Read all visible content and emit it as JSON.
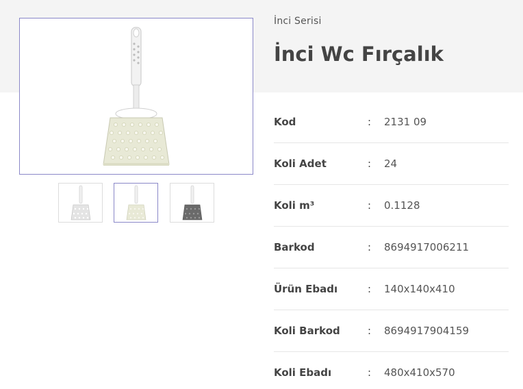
{
  "product": {
    "series": "İnci Serisi",
    "title": "İnci Wc Fırçalık"
  },
  "gallery": {
    "main_color": "#e8e9d6",
    "thumbnails": [
      {
        "color": "#e4e4e4",
        "icon": "brush-holder-white-thumbnail"
      },
      {
        "color": "#e8e9d6",
        "icon": "brush-holder-cream-thumbnail",
        "active": true
      },
      {
        "color": "#6a6a6a",
        "icon": "brush-holder-grey-thumbnail"
      }
    ]
  },
  "specs": [
    {
      "label": "Kod",
      "colon": ":",
      "value": "2131 09"
    },
    {
      "label": "Koli Adet",
      "colon": ":",
      "value": "24"
    },
    {
      "label": "Koli m³",
      "colon": ":",
      "value": "0.1128"
    },
    {
      "label": "Barkod",
      "colon": ":",
      "value": "8694917006211"
    },
    {
      "label": "Ürün Ebadı",
      "colon": ":",
      "value": "140x140x410"
    },
    {
      "label": "Koli Barkod",
      "colon": ":",
      "value": "8694917904159"
    },
    {
      "label": "Koli Ebadı",
      "colon": ":",
      "value": " 480x410x570"
    }
  ]
}
